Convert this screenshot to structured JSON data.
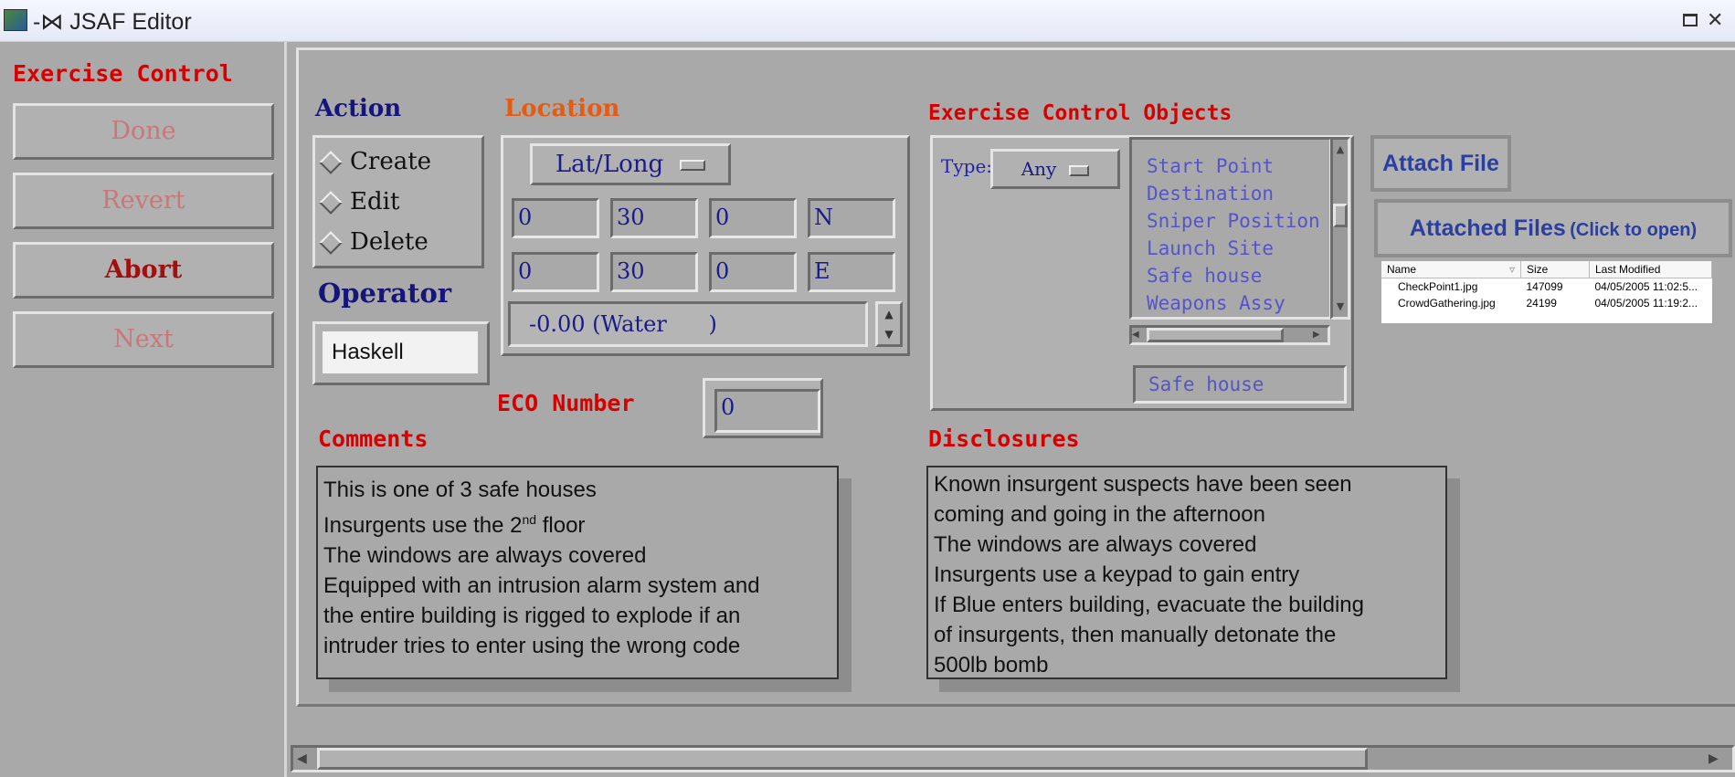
{
  "window": {
    "title": "-⋈ JSAF Editor"
  },
  "sidebar": {
    "heading": "Exercise Control",
    "buttons": [
      {
        "label": "Done"
      },
      {
        "label": "Revert"
      },
      {
        "label": "Abort"
      },
      {
        "label": "Next"
      }
    ]
  },
  "action": {
    "label": "Action",
    "options": [
      "Create",
      "Edit",
      "Delete"
    ]
  },
  "operator": {
    "label": "Operator",
    "value": "Haskell"
  },
  "location": {
    "label": "Location",
    "mode": "Lat/Long",
    "lat": [
      "0",
      "30",
      "0",
      "N"
    ],
    "long": [
      "0",
      "30",
      "0",
      "E"
    ],
    "elevation": "-0.00 (Water      )"
  },
  "eco": {
    "label": "ECO Number",
    "value": "0"
  },
  "objects": {
    "label": "Exercise Control Objects",
    "type_label": "Type:",
    "type_value": "Any",
    "items": [
      "Start Point",
      "Destination",
      "Sniper Position",
      "Launch Site",
      "Safe house",
      "Weapons Assy"
    ],
    "selected": "Safe house"
  },
  "attach": {
    "attach_label": "Attach File",
    "attached_label": "Attached Files",
    "attached_hint": "(Click to open)",
    "columns": [
      "Name",
      "Size",
      "Last Modified"
    ],
    "files": [
      {
        "name": "CheckPoint1.jpg",
        "size": "147099",
        "modified": "04/05/2005 11:02:5..."
      },
      {
        "name": "CrowdGathering.jpg",
        "size": "24199",
        "modified": "04/05/2005 11:19:2..."
      }
    ]
  },
  "comments": {
    "label": "Comments",
    "lines": [
      "This is one of 3 safe houses",
      "Insurgents use the 2",
      "nd",
      " floor",
      "The windows are always covered",
      "Equipped with an intrusion alarm system and",
      "the entire building is rigged to explode if an",
      "intruder tries to enter using the wrong code"
    ]
  },
  "disclosures": {
    "label": "Disclosures",
    "lines": [
      "Known insurgent suspects have been seen",
      "coming and going in the afternoon",
      "The windows are always covered",
      "Insurgents use a keypad to gain entry",
      "If Blue enters building, evacuate the building",
      "of insurgents, then manually detonate the",
      "500lb bomb"
    ]
  }
}
